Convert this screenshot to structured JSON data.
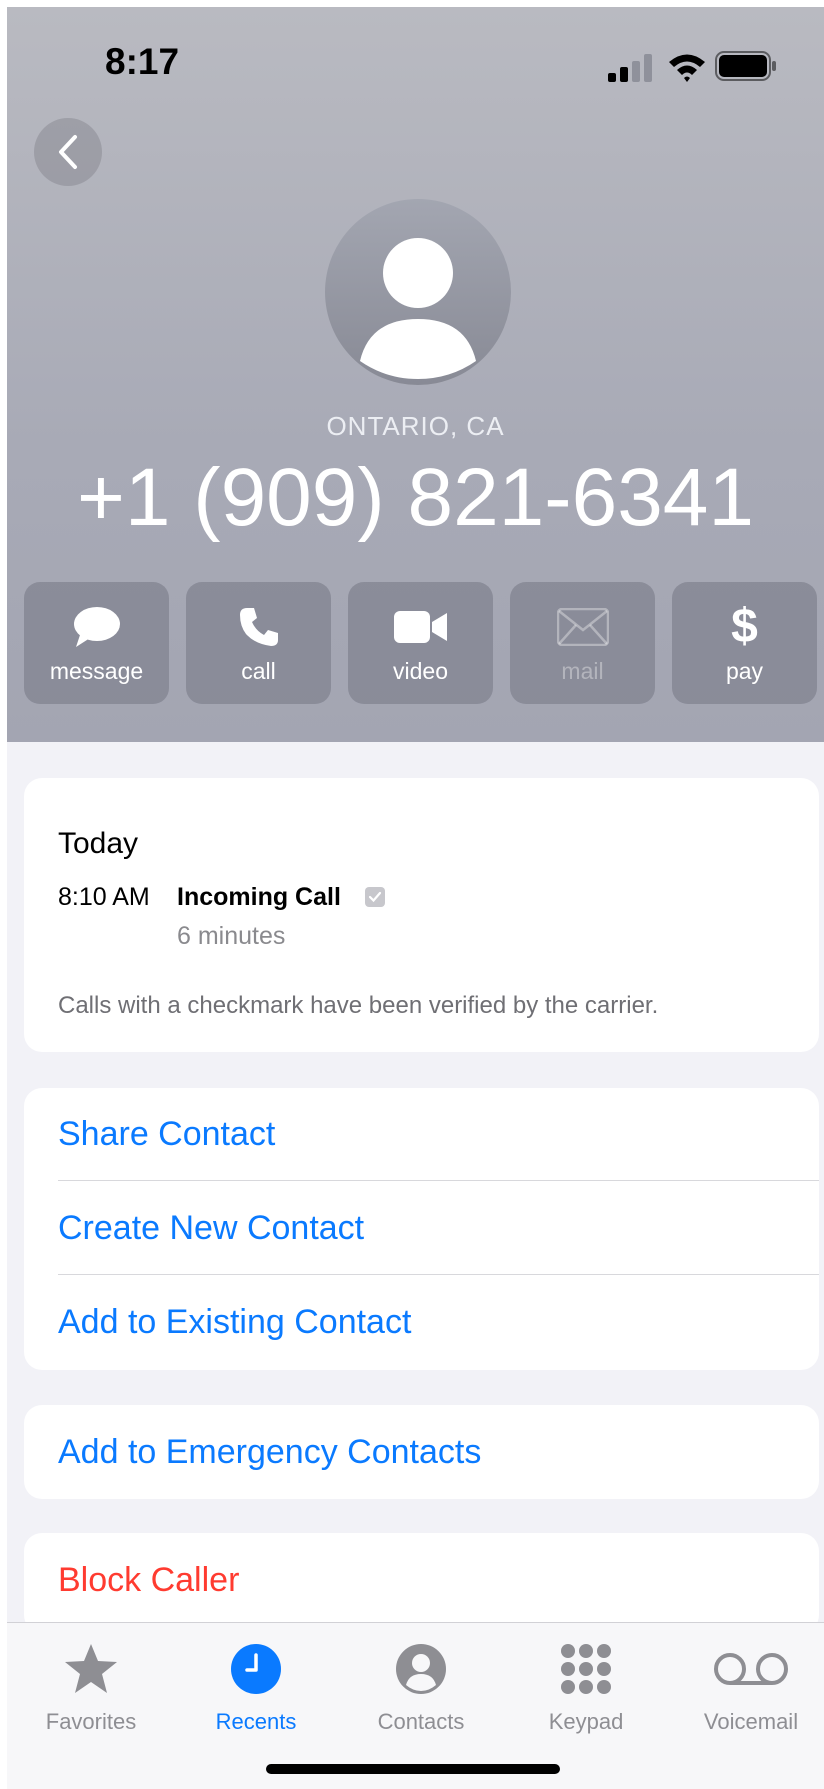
{
  "status_bar": {
    "time": "8:17"
  },
  "contact": {
    "location": "ONTARIO, CA",
    "phone_number": "+1 (909) 821-6341"
  },
  "actions": [
    {
      "label": "message",
      "icon": "message-bubble-icon",
      "enabled": true
    },
    {
      "label": "call",
      "icon": "phone-icon",
      "enabled": true
    },
    {
      "label": "video",
      "icon": "video-camera-icon",
      "enabled": true
    },
    {
      "label": "mail",
      "icon": "envelope-icon",
      "enabled": false
    },
    {
      "label": "pay",
      "icon": "dollar-icon",
      "enabled": true
    }
  ],
  "recents": {
    "day": "Today",
    "time": "8:10 AM",
    "type": "Incoming Call",
    "duration": "6 minutes",
    "note": "Calls with a checkmark have been verified by the carrier."
  },
  "options": {
    "share_contact": "Share Contact",
    "create_new_contact": "Create New Contact",
    "add_to_existing": "Add to Existing Contact",
    "add_to_emergency": "Add to Emergency Contacts",
    "block_caller": "Block Caller"
  },
  "tabs": [
    {
      "label": "Favorites",
      "icon": "star-icon",
      "active": false
    },
    {
      "label": "Recents",
      "icon": "clock-icon",
      "active": true
    },
    {
      "label": "Contacts",
      "icon": "person-circle-icon",
      "active": false
    },
    {
      "label": "Keypad",
      "icon": "keypad-icon",
      "active": false
    },
    {
      "label": "Voicemail",
      "icon": "voicemail-icon",
      "active": false
    }
  ],
  "colors": {
    "accent": "#0a7aff",
    "destructive": "#ff3b30",
    "background": "#f2f2f7"
  }
}
